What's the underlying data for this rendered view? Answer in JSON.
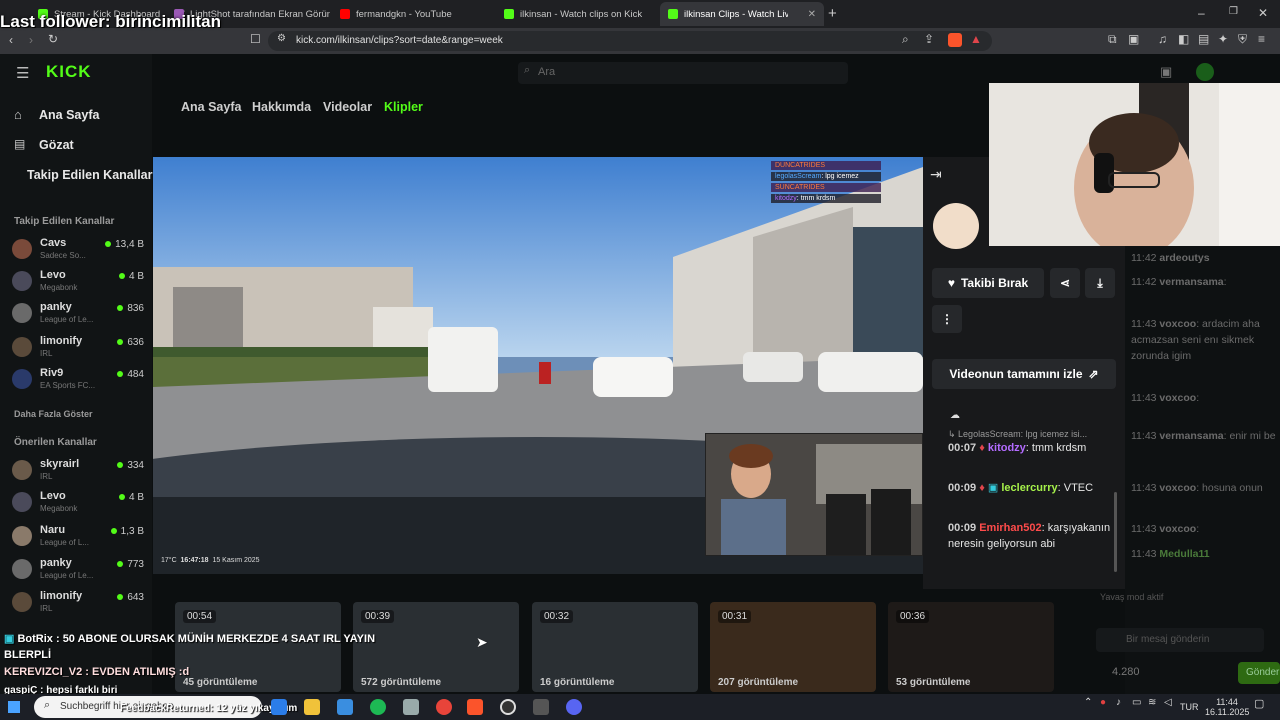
{
  "browser": {
    "tabs": [
      {
        "title": "Stream - Kick Dashboard",
        "color": "#53fc18"
      },
      {
        "title": "LightShot tarafından Ekran Görüntüsü",
        "color": "#9b59b6"
      },
      {
        "title": "fermandgkn - YouTube",
        "color": "#ff0000"
      },
      {
        "title": "ilkinsan - Watch clips on Kick",
        "color": "#53fc18"
      },
      {
        "title": "ilkinsan Clips - Watch Live on Kick",
        "color": "#53fc18"
      }
    ],
    "url": "kick.com/ilkinsan/clips?sort=date&range=week",
    "add_tab": "+"
  },
  "overlay": {
    "last_follower": "Last follower: birincimilitan",
    "lines": [
      "BotRix : 50 ABONE OLURSAK MÜNİH MERKEZDE 4 SAAT IRL YAYIN",
      "BLERPLİ",
      "KEREVIZCI_V2 : EVDEN ATILMIŞ :d",
      "gaspiÇ : hepsi farklı biri",
      "FeedbackReturned: 12 yüz yıkayayım"
    ]
  },
  "kick": {
    "logo": "KICK",
    "search_placeholder": "Ara",
    "nav": [
      {
        "label": "Ana Sayfa",
        "icon": "home-icon"
      },
      {
        "label": "Gözat",
        "icon": "browse-icon"
      }
    ],
    "followed_heading": "Takip Edilen Kanallar",
    "followed_section": "Takip Edilen Kanallar",
    "followed": [
      {
        "name": "Cavs",
        "sub": "Sadece So...",
        "viewers": "13,4 B"
      },
      {
        "name": "Levo",
        "sub": "Megabonk",
        "viewers": "4 B"
      },
      {
        "name": "panky",
        "sub": "League of Le...",
        "viewers": "836"
      },
      {
        "name": "limonify",
        "sub": "IRL",
        "viewers": "636"
      },
      {
        "name": "Riv9",
        "sub": "EA Sports FC...",
        "viewers": "484"
      }
    ],
    "show_more": "Daha Fazla Göster",
    "suggested_section": "Önerilen Kanallar",
    "suggested": [
      {
        "name": "skyrairl",
        "sub": "IRL",
        "viewers": "334"
      },
      {
        "name": "Levo",
        "sub": "Megabonk",
        "viewers": "4 B"
      },
      {
        "name": "Naru",
        "sub": "League of L...",
        "viewers": "1,3 B"
      },
      {
        "name": "panky",
        "sub": "League of Le...",
        "viewers": "773"
      },
      {
        "name": "limonify",
        "sub": "IRL",
        "viewers": "643"
      }
    ],
    "profile_tabs": [
      "Ana Sayfa",
      "Hakkımda",
      "Videolar",
      "Klipler"
    ],
    "accent": "#53fc18"
  },
  "clip_modal": {
    "unfollow": "Takibi Bırak",
    "watch_full": "Videonun tamamını izle",
    "video_timestamp": "16:47:18",
    "video_date": "15 Kasım 2025",
    "video_temp": "17°C",
    "reply_to": "LegolasScream: lpg icemez isi...",
    "messages": [
      {
        "time": "00:07",
        "user": "kitodzy",
        "color": "#b36bff",
        "text": "tmm krdsm"
      },
      {
        "time": "00:09",
        "user": "leclercurry",
        "color": "#a5f04a",
        "text": "VTEC"
      },
      {
        "time": "00:09",
        "user": "Emirhan502",
        "color": "#ff4b4b",
        "text": "karşıyakanın neresin geliyorsun abi"
      }
    ],
    "overlay_chat": [
      {
        "user": "DUNCATRIDES",
        "text": ""
      },
      {
        "user": "legolasScream",
        "text": "lpg icemez"
      },
      {
        "user": "SUNCATRIDES",
        "text": ""
      },
      {
        "user": "kitodzy",
        "text": "tmm krdsm"
      }
    ]
  },
  "right_chat": [
    {
      "time": "11:42",
      "user": "ardeoutys",
      "text": ""
    },
    {
      "time": "11:42",
      "user": "vermansama",
      "text": ""
    },
    {
      "time": "11:43",
      "user": "voxcoo",
      "text": "ardacim aha acmazsan seni enı sikmek zorunda igim"
    },
    {
      "time": "11:43",
      "user": "voxcoo",
      "text": ""
    },
    {
      "time": "11:43",
      "user": "vermansama",
      "text": "enir mi be"
    },
    {
      "time": "11:43",
      "user": "voxcoo",
      "text": "hosuna onun"
    },
    {
      "time": "11:43",
      "user": "voxcoo",
      "text": ""
    },
    {
      "time": "11:43",
      "user": "Medulla11",
      "text": ""
    }
  ],
  "chat_input_placeholder": "Bir mesaj gönderin",
  "chat_mode": "Yavaş mod aktif",
  "viewer_count": "4.280",
  "send_label": "Gönder",
  "clips": [
    {
      "duration": "00:54",
      "views": "45 görüntüleme"
    },
    {
      "duration": "00:39",
      "views": "572 görüntüleme"
    },
    {
      "duration": "00:32",
      "views": "16 görüntüleme"
    },
    {
      "duration": "00:31",
      "views": "207 görüntüleme"
    },
    {
      "duration": "00:36",
      "views": "53 görüntüleme"
    }
  ],
  "taskbar": {
    "search_placeholder": "Suchbegriff hier eingeben",
    "lang": "TUR",
    "time": "11:44",
    "date": "16.11.2025"
  }
}
